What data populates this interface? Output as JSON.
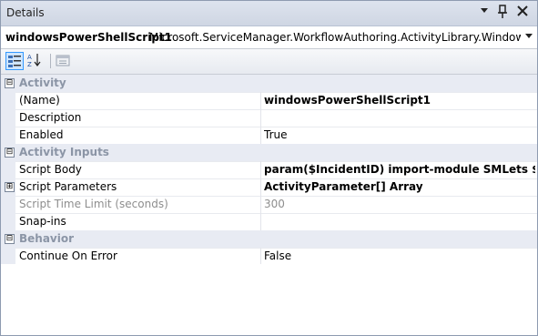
{
  "window": {
    "title": "Details",
    "dropdown_glyph": "▼",
    "pin_glyph": "❙",
    "close_glyph": "✕"
  },
  "object": {
    "name": "windowsPowerShellScript1",
    "type": "Microsoft.ServiceManager.WorkflowAuthoring.ActivityLibrary.WindowsPowerShellScript"
  },
  "toolbar": {
    "categorized_icon": "categorized-icon",
    "alphabetical_icon": "alphabetical-icon",
    "property_pages_icon": "property-pages-icon"
  },
  "grid": {
    "categories": [
      {
        "label": "Activity",
        "expander": "⊟"
      },
      {
        "label": "Activity Inputs",
        "expander": "⊟"
      },
      {
        "label": "Behavior",
        "expander": "⊟"
      }
    ],
    "properties": [
      {
        "name": "(Name)",
        "value": "windowsPowerShellScript1"
      },
      {
        "name": "Description",
        "value": ""
      },
      {
        "name": "Enabled",
        "value": "True"
      },
      {
        "name": "Script Body",
        "value": "param($IncidentID) import-module SMLets $Date = (Get-Date)"
      },
      {
        "name": "Script Parameters",
        "value": "ActivityParameter[] Array",
        "expander": "⊞"
      },
      {
        "name": "Script Time Limit (seconds)",
        "value": "300"
      },
      {
        "name": "Snap-ins",
        "value": ""
      },
      {
        "name": "Continue On Error",
        "value": "False"
      }
    ]
  }
}
